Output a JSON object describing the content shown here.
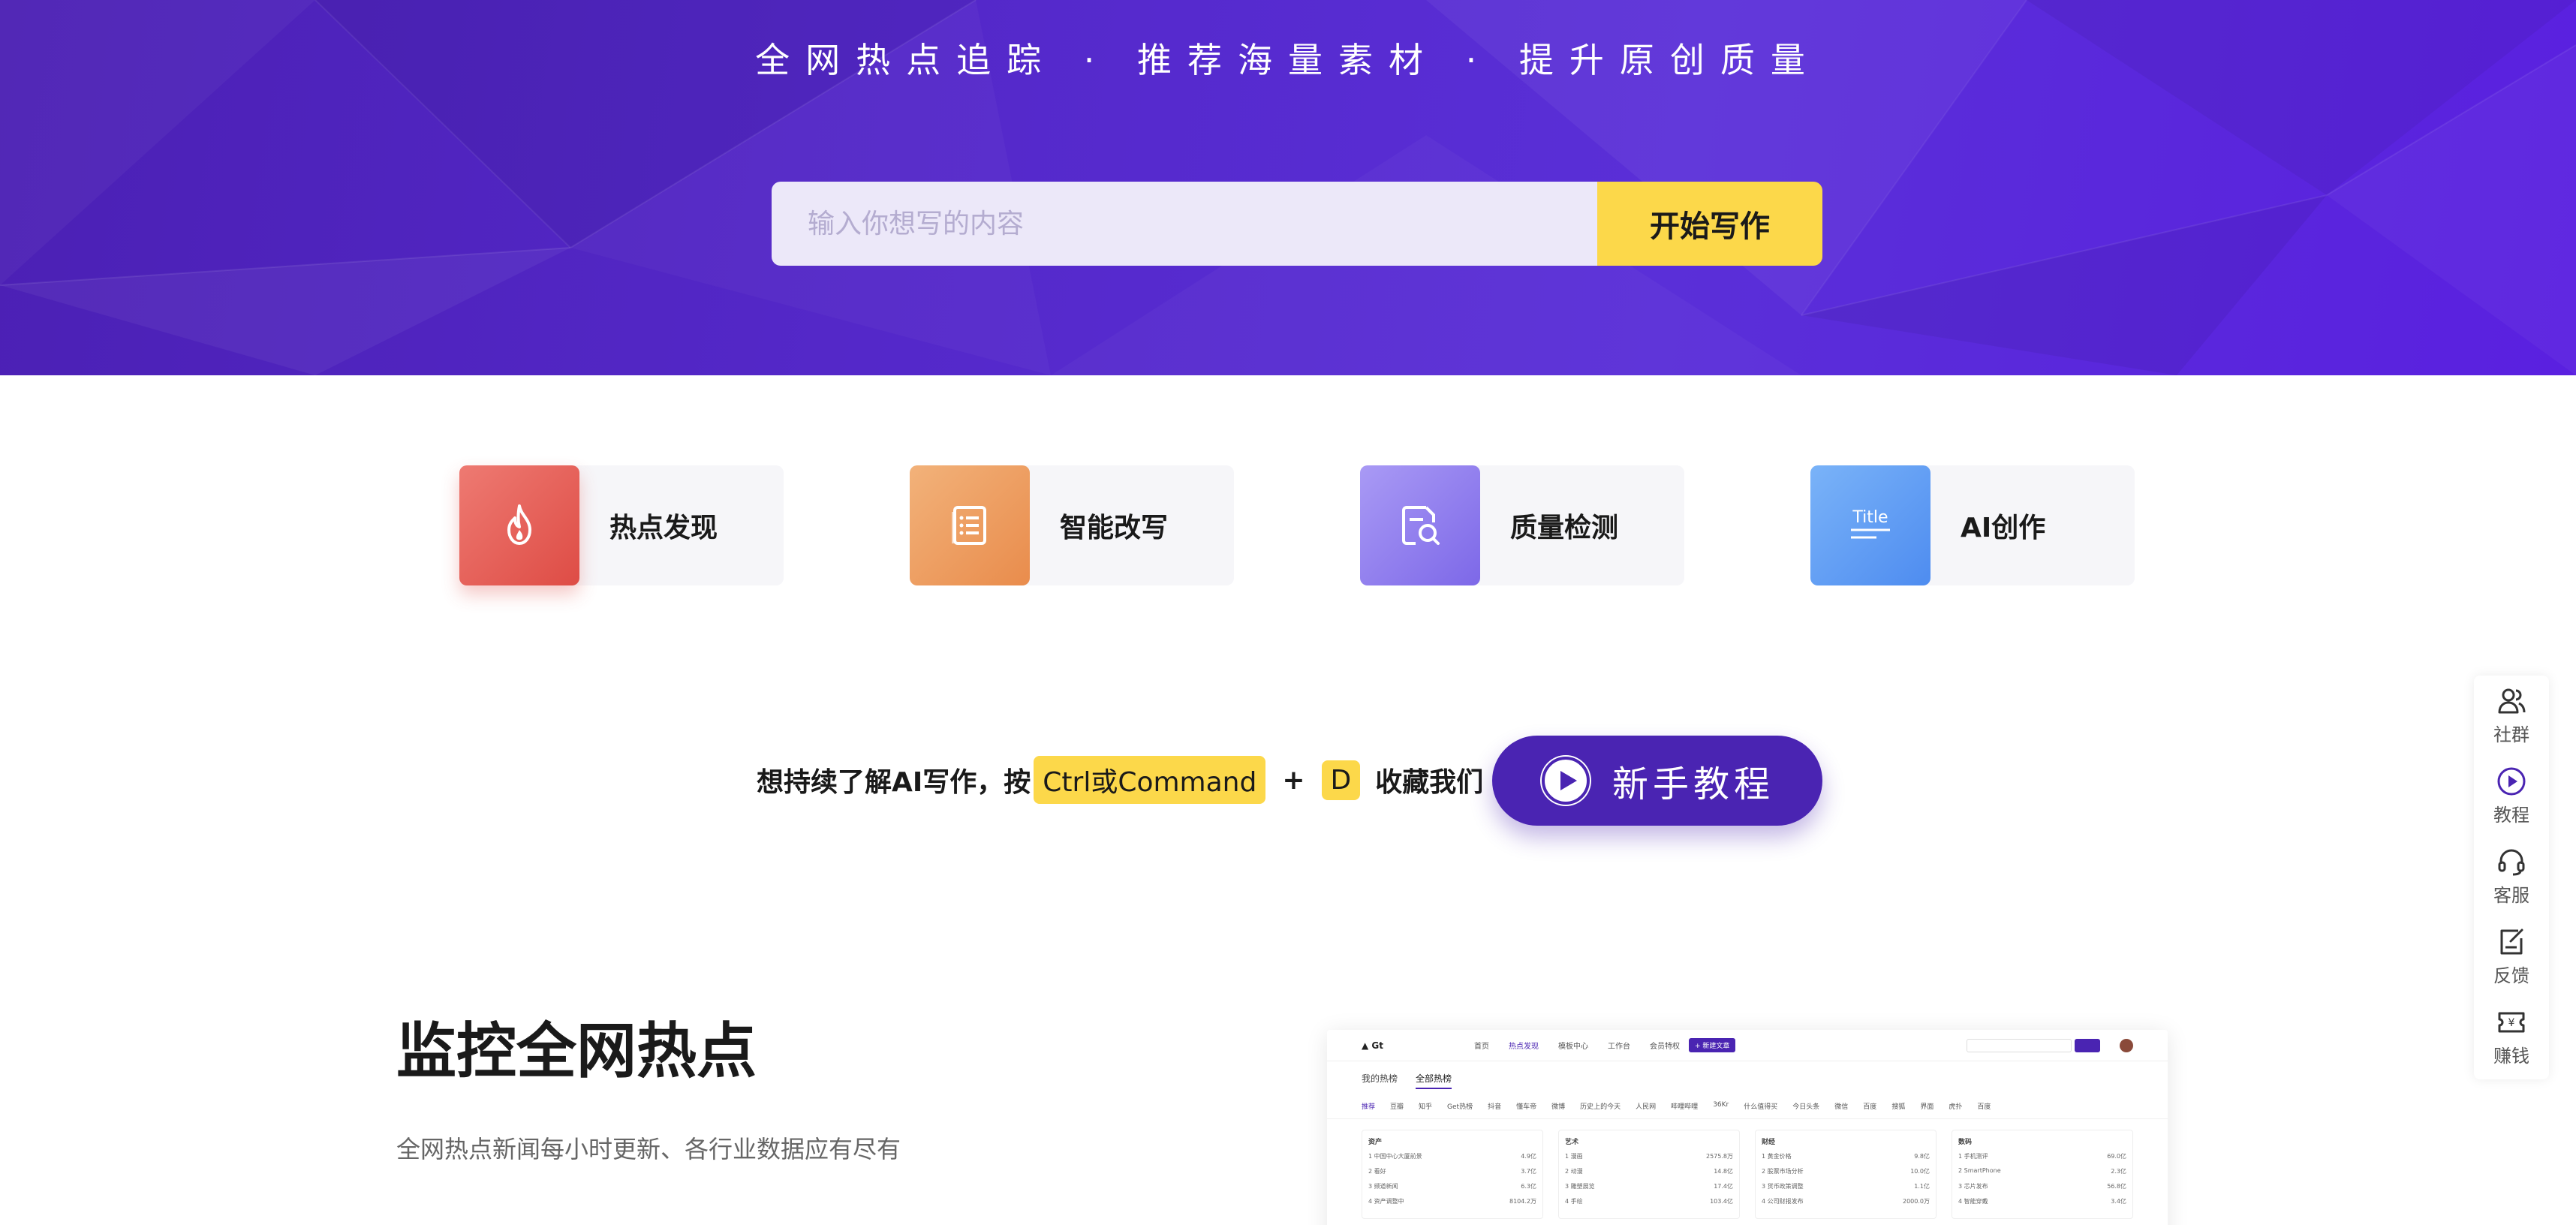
{
  "hero": {
    "tagline": "全网热点追踪 · 推荐海量素材 · 提升原创质量",
    "search_placeholder": "输入你想写的内容",
    "search_button": "开始写作"
  },
  "features": [
    {
      "label": "热点发现",
      "icon": "flame-icon"
    },
    {
      "label": "智能改写",
      "icon": "document-list-icon"
    },
    {
      "label": "质量检测",
      "icon": "document-search-icon"
    },
    {
      "label": "AI创作",
      "icon": "title-icon"
    }
  ],
  "feature_icon_text": "Title",
  "bookmark": {
    "prefix": "想持续了解AI写作，按",
    "key1": "Ctrl或Command",
    "plus": "+",
    "key2": "D",
    "suffix": "收藏我们"
  },
  "tutorial_button": "新手教程",
  "section": {
    "title": "监控全网热点",
    "subtitle": "全网热点新闻每小时更新、各行业数据应有尽有"
  },
  "preview": {
    "logo": "Gt",
    "nav": [
      "首页",
      "热点发现",
      "模板中心",
      "工作台",
      "会员特权"
    ],
    "new_button": "+ 新建文章",
    "tabs": [
      "我的热榜",
      "全部热榜"
    ],
    "cats": [
      "推荐",
      "豆瓣",
      "知乎",
      "Get热榜",
      "抖音",
      "懂车帝",
      "微博",
      "历史上的今天",
      "人民网",
      "哔哩哔哩",
      "36Kr",
      "什么值得买",
      "今日头条",
      "微信",
      "百度",
      "搜狐",
      "界面",
      "虎扑",
      "百度"
    ],
    "cols": [
      {
        "name": "资产",
        "rows": [
          {
            "t": "1  中国中心大厦前景",
            "v": "4.9亿"
          },
          {
            "t": "2  看好",
            "v": "3.7亿"
          },
          {
            "t": "3  频道新闻",
            "v": "6.3亿"
          },
          {
            "t": "4  资产调整中",
            "v": "8104.2万"
          }
        ]
      },
      {
        "name": "艺术",
        "rows": [
          {
            "t": "1  漫画",
            "v": "2575.8万"
          },
          {
            "t": "2  动漫",
            "v": "14.8亿"
          },
          {
            "t": "3  雕塑展览",
            "v": "17.4亿"
          },
          {
            "t": "4  手绘",
            "v": "103.4亿"
          }
        ]
      },
      {
        "name": "财经",
        "rows": [
          {
            "t": "1  黄金价格",
            "v": "9.8亿"
          },
          {
            "t": "2  股票市场分析",
            "v": "10.0亿"
          },
          {
            "t": "3  货币政策调整",
            "v": "1.1亿"
          },
          {
            "t": "4  公司财报发布",
            "v": "2000.0万"
          }
        ]
      },
      {
        "name": "数码",
        "rows": [
          {
            "t": "1  手机测评",
            "v": "69.0亿"
          },
          {
            "t": "2  SmartPhone",
            "v": "2.3亿"
          },
          {
            "t": "3  芯片发布",
            "v": "56.8亿"
          },
          {
            "t": "4  智能穿戴",
            "v": "3.4亿"
          }
        ]
      }
    ]
  },
  "side_panel": [
    {
      "label": "社群",
      "icon": "community-icon"
    },
    {
      "label": "教程",
      "icon": "play-icon"
    },
    {
      "label": "客服",
      "icon": "headset-icon"
    },
    {
      "label": "反馈",
      "icon": "feedback-icon"
    },
    {
      "label": "赚钱",
      "icon": "yen-coupon-icon"
    }
  ],
  "colors": {
    "hero_purple": "#5428c9",
    "accent_yellow": "#fcd84a",
    "button_purple": "#4a24b2"
  }
}
